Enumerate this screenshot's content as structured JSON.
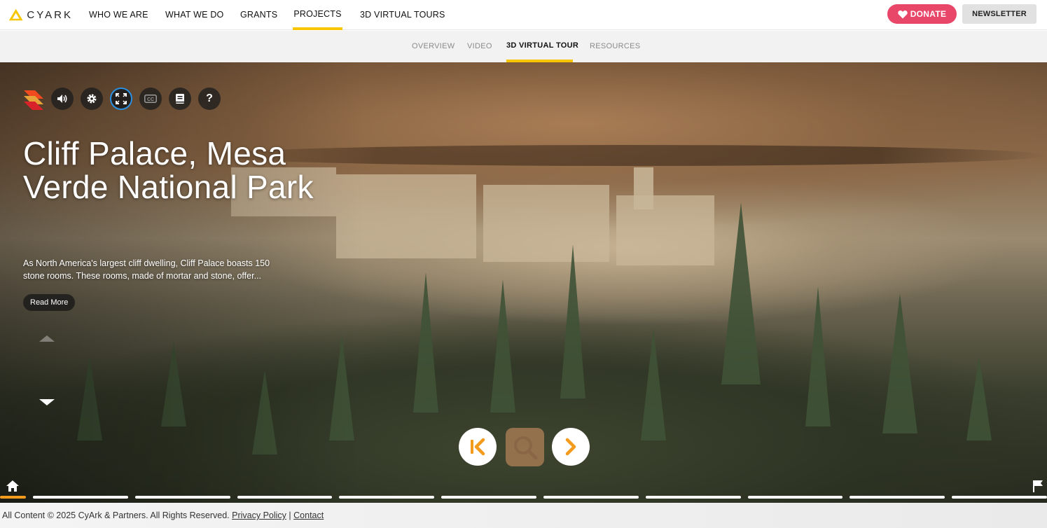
{
  "brand": {
    "name": "CYARK",
    "accent_color": "#f7c600"
  },
  "topnav": {
    "items": [
      {
        "label": "WHO WE ARE"
      },
      {
        "label": "WHAT WE DO"
      },
      {
        "label": "GRANTS"
      },
      {
        "label": "PROJECTS",
        "active": true
      },
      {
        "label": "3D VIRTUAL TOURS"
      }
    ],
    "donate_label": "DONATE",
    "donate_color": "#e8476a",
    "newsletter_label": "NEWSLETTER"
  },
  "subnav": {
    "items": [
      {
        "label": "OVERVIEW"
      },
      {
        "label": "VIDEO"
      },
      {
        "label": "3D VIRTUAL TOUR",
        "active": true
      },
      {
        "label": "RESOURCES"
      }
    ]
  },
  "viewer": {
    "toolbar": [
      {
        "icon": "sketchfab-logo-icon"
      },
      {
        "icon": "volume-icon"
      },
      {
        "icon": "settings-gear-icon"
      },
      {
        "icon": "fullscreen-icon",
        "selected": true
      },
      {
        "icon": "closed-captions-icon"
      },
      {
        "icon": "book-icon"
      },
      {
        "icon": "help-icon",
        "text": "?"
      }
    ],
    "title": "Cliff Palace, Mesa Verde National Park",
    "description": "As North America's largest cliff dwelling, Cliff Palace boasts 150 stone rooms. These rooms, made of mortar and stone, offer...",
    "read_more_label": "Read More",
    "controls": [
      {
        "icon": "skip-to-start-icon"
      },
      {
        "icon": "search-icon"
      },
      {
        "icon": "next-arrow-icon"
      }
    ],
    "control_accent": "#f29b1d",
    "progress": {
      "segments": 11,
      "current": 1
    }
  },
  "footer": {
    "copyright": "All Content © 2025 CyArk & Partners. All Rights Reserved.",
    "privacy_label": "Privacy Policy",
    "separator": "|",
    "contact_label": "Contact"
  }
}
